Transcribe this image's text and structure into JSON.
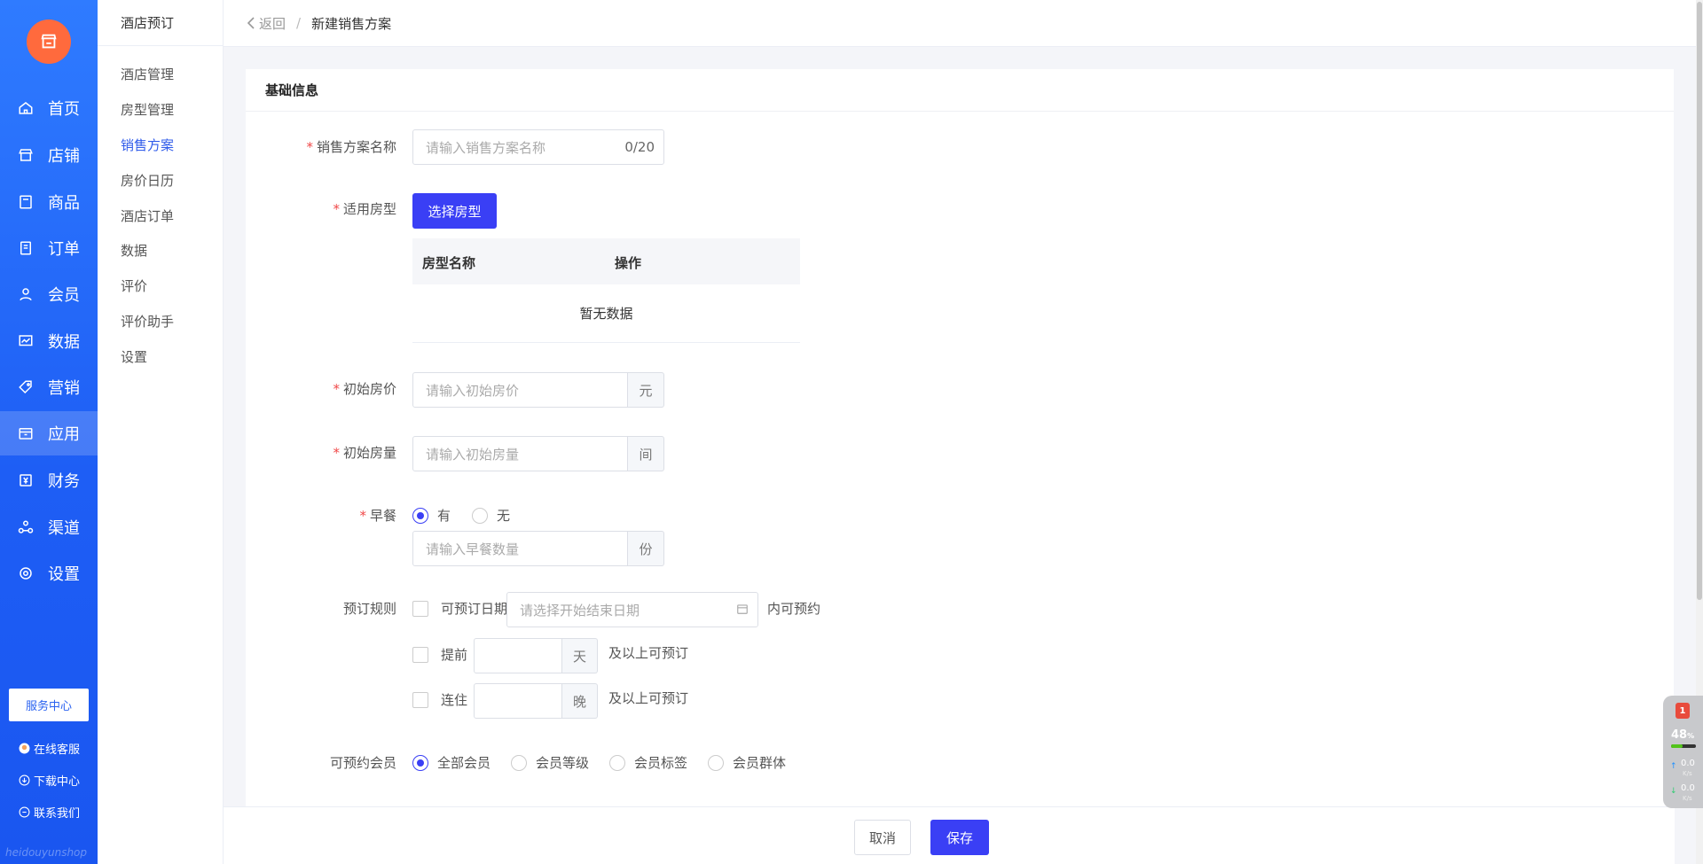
{
  "nav": {
    "items": [
      {
        "label": "首页",
        "icon": "home-icon"
      },
      {
        "label": "店铺",
        "icon": "store-icon"
      },
      {
        "label": "商品",
        "icon": "bag-icon"
      },
      {
        "label": "订单",
        "icon": "document-icon"
      },
      {
        "label": "会员",
        "icon": "user-icon"
      },
      {
        "label": "数据",
        "icon": "chart-icon"
      },
      {
        "label": "营销",
        "icon": "tag-icon"
      },
      {
        "label": "应用",
        "icon": "box-icon"
      },
      {
        "label": "财务",
        "icon": "finance-icon"
      },
      {
        "label": "渠道",
        "icon": "channel-icon"
      },
      {
        "label": "设置",
        "icon": "gear-icon"
      }
    ],
    "active_index": 7,
    "service_center": "服务中心",
    "links": [
      {
        "label": "在线客服",
        "icon": "support-avatar-icon"
      },
      {
        "label": "下载中心",
        "icon": "download-icon"
      },
      {
        "label": "联系我们",
        "icon": "chat-icon"
      }
    ],
    "watermark": "heidouyunshop"
  },
  "subnav": {
    "title": "酒店预订",
    "items": [
      "酒店管理",
      "房型管理",
      "销售方案",
      "房价日历",
      "酒店订单",
      "数据",
      "评价",
      "评价助手",
      "设置"
    ],
    "active_index": 2
  },
  "header": {
    "back": "返回",
    "separator": "/",
    "current": "新建销售方案"
  },
  "form": {
    "section_title": "基础信息",
    "plan_name": {
      "label": "销售方案名称",
      "placeholder": "请输入销售方案名称",
      "count": "0/20"
    },
    "room_type": {
      "label": "适用房型",
      "button": "选择房型",
      "columns": [
        "房型名称",
        "操作"
      ],
      "empty": "暂无数据"
    },
    "initial_price": {
      "label": "初始房价",
      "placeholder": "请输入初始房价",
      "unit": "元"
    },
    "initial_rooms": {
      "label": "初始房量",
      "placeholder": "请输入初始房量",
      "unit": "间"
    },
    "breakfast": {
      "label": "早餐",
      "options": [
        "有",
        "无"
      ],
      "selected": 0,
      "placeholder": "请输入早餐数量",
      "unit": "份"
    },
    "booking_rules": {
      "label": "预订规则",
      "date_check": "可预订日期",
      "date_placeholder": "请选择开始结束日期",
      "date_suffix": "内可预约",
      "advance_check": "提前",
      "advance_unit": "天",
      "advance_suffix": "及以上可预订",
      "stay_check": "连住",
      "stay_unit": "晚",
      "stay_suffix": "及以上可预订"
    },
    "members": {
      "label": "可预约会员",
      "options": [
        "全部会员",
        "会员等级",
        "会员标签",
        "会员群体"
      ],
      "selected": 0
    }
  },
  "footer": {
    "cancel": "取消",
    "save": "保存"
  },
  "widget": {
    "badge": "1",
    "percent": "48",
    "percent_unit": "%",
    "percent_value": 0.48,
    "up": "0.0",
    "down": "0.0",
    "unit": "K/s"
  },
  "colors": {
    "primary": "#3a3ff5",
    "nav_bg": "#1e5ef5",
    "logo": "#ff6a3d",
    "required": "#f04848"
  }
}
